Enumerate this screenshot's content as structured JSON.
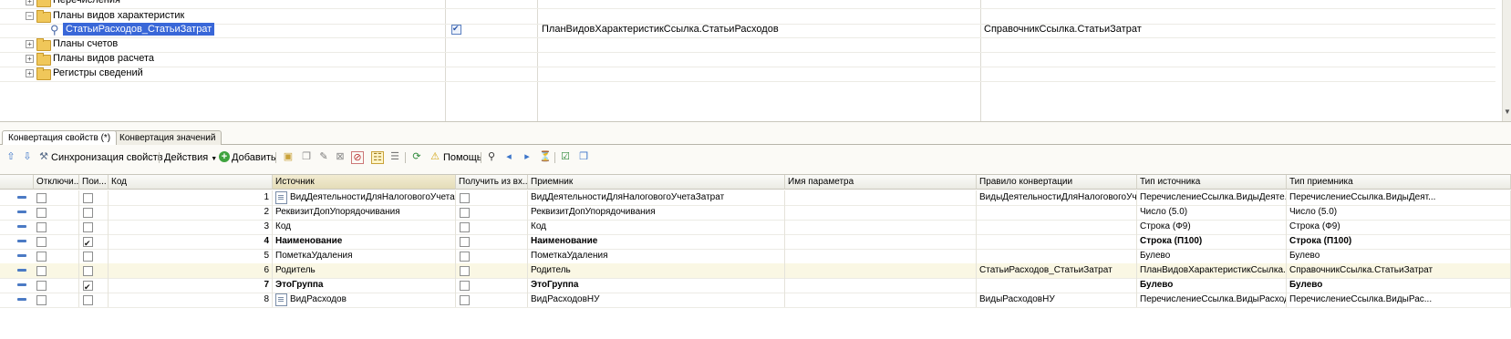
{
  "tree": {
    "rows": [
      {
        "label": "Перечисления",
        "expander": "+"
      },
      {
        "label": "Планы видов характеристик",
        "expander": "−"
      },
      {
        "label": "СтатьиРасходов_СтатьиЗатрат",
        "checked": true,
        "col2": "ПланВидовХарактеристикСсылка.СтатьиРасходов",
        "col3": "СправочникСсылка.СтатьиЗатрат"
      },
      {
        "label": "Планы счетов",
        "expander": "+"
      },
      {
        "label": "Планы видов расчета",
        "expander": "+"
      },
      {
        "label": "Регистры сведений",
        "expander": "+"
      }
    ]
  },
  "tabs": [
    {
      "label": "Конвертация свойств (*)",
      "active": true
    },
    {
      "label": "Конвертация значений",
      "active": false
    }
  ],
  "toolbar": {
    "sync_label": "Синхронизация свойств ...",
    "actions_label": "Действия",
    "add_label": "Добавить",
    "help_label": "Помощь"
  },
  "grid": {
    "headers": {
      "disabled": "Отключи...",
      "search": "Пои...",
      "code": "Код",
      "source": "Источник",
      "get_from": "Получить из вх...",
      "receiver": "Приемник",
      "param": "Имя параметра",
      "rule": "Правило конвертации",
      "src_type": "Тип источника",
      "dst_type": "Тип приемника"
    },
    "rows": [
      {
        "search": false,
        "code": "1",
        "source": "ВидДеятельностиДляНалоговогоУчета...",
        "receiver": "ВидДеятельностиДляНалоговогоУчетаЗатрат",
        "rule": "ВидыДеятельностиДляНалоговогоУч...",
        "src_type": "ПеречислениеСсылка.ВидыДеяте...",
        "dst_type": "ПеречислениеСсылка.ВидыДеят...",
        "bold": false,
        "icon": true,
        "highlight": false
      },
      {
        "search": false,
        "code": "2",
        "source": "РеквизитДопУпорядочивания",
        "receiver": "РеквизитДопУпорядочивания",
        "rule": "",
        "src_type": "Число (5.0)",
        "dst_type": "Число (5.0)",
        "bold": false,
        "icon": false,
        "highlight": false
      },
      {
        "search": false,
        "code": "3",
        "source": "Код",
        "receiver": "Код",
        "rule": "",
        "src_type": "Строка (Ф9)",
        "dst_type": "Строка (Ф9)",
        "bold": false,
        "icon": false,
        "highlight": false
      },
      {
        "search": true,
        "code": "4",
        "source": "Наименование",
        "receiver": "Наименование",
        "rule": "",
        "src_type": "Строка (П100)",
        "dst_type": "Строка (П100)",
        "bold": true,
        "icon": false,
        "highlight": false
      },
      {
        "search": false,
        "code": "5",
        "source": "ПометкаУдаления",
        "receiver": "ПометкаУдаления",
        "rule": "",
        "src_type": "Булево",
        "dst_type": "Булево",
        "bold": false,
        "icon": false,
        "highlight": false
      },
      {
        "search": false,
        "code": "6",
        "source": "Родитель",
        "receiver": "Родитель",
        "rule": "СтатьиРасходов_СтатьиЗатрат",
        "src_type": "ПланВидовХарактеристикСсылка....",
        "dst_type": "СправочникСсылка.СтатьиЗатрат",
        "bold": false,
        "icon": false,
        "highlight": true
      },
      {
        "search": true,
        "code": "7",
        "source": "ЭтоГруппа",
        "receiver": "ЭтоГруппа",
        "rule": "",
        "src_type": "Булево",
        "dst_type": "Булево",
        "bold": true,
        "icon": false,
        "highlight": false
      },
      {
        "search": false,
        "code": "8",
        "source": "ВидРасходов",
        "receiver": "ВидРасходовНУ",
        "rule": "ВидыРасходовНУ",
        "src_type": "ПеречислениеСсылка.ВидыРасход...",
        "dst_type": "ПеречислениеСсылка.ВидыРас...",
        "bold": false,
        "icon": true,
        "highlight": false
      }
    ]
  },
  "colors": {
    "selection": "#3967d8",
    "row_highlight": "#faf7e4",
    "folder": "#f0c75a",
    "row_marker": "#4b7ac4"
  }
}
